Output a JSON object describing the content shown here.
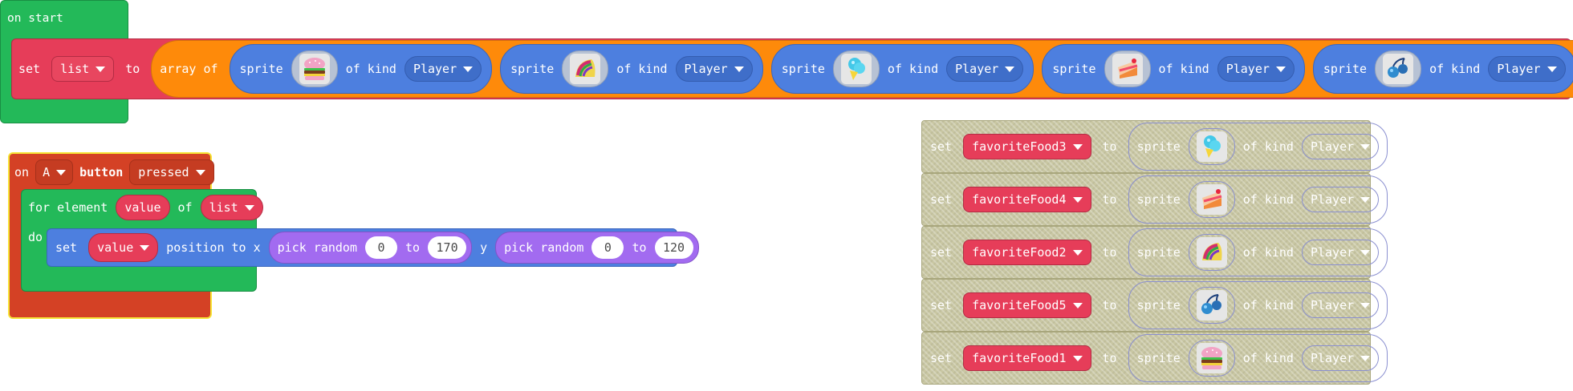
{
  "colors": {
    "event": "#23b959",
    "variable": "#e63d59",
    "array": "#fe8a0a",
    "sprite": "#4d7fdf",
    "math": "#a26bf0",
    "controller": "#d44125",
    "disabled": "#c9c7a3"
  },
  "on_start": {
    "hat_label": "on start",
    "set_label": "set",
    "var": "list",
    "to_label": "to",
    "array_label": "array of",
    "items": [
      {
        "sprite_label": "sprite",
        "icon": "burger-icon",
        "kind_label": "of kind",
        "kind": "Player"
      },
      {
        "sprite_label": "sprite",
        "icon": "taco-icon",
        "kind_label": "of kind",
        "kind": "Player"
      },
      {
        "sprite_label": "sprite",
        "icon": "ice-cream-icon",
        "kind_label": "of kind",
        "kind": "Player"
      },
      {
        "sprite_label": "sprite",
        "icon": "cake-icon",
        "kind_label": "of kind",
        "kind": "Player"
      },
      {
        "sprite_label": "sprite",
        "icon": "cherries-icon",
        "kind_label": "of kind",
        "kind": "Player"
      }
    ],
    "remove_symbol": "−",
    "add_symbol": "+"
  },
  "on_button": {
    "on_label": "on",
    "button": "A",
    "button_label": "button",
    "event": "pressed",
    "for_label": "for element",
    "elem_var": "value",
    "of_label": "of",
    "list_var": "list",
    "do_label": "do",
    "set_label": "set",
    "target_var": "value",
    "position_label": "position to x",
    "pick1_label": "pick random",
    "pick1_from": "0",
    "pick1_to_label": "to",
    "pick1_to": "170",
    "y_label": "y",
    "pick2_label": "pick random",
    "pick2_from": "0",
    "pick2_to_label": "to",
    "pick2_to": "120"
  },
  "disabled_sets": [
    {
      "set_label": "set",
      "var": "favoriteFood3",
      "to_label": "to",
      "sprite_label": "sprite",
      "icon": "ice-cream-icon",
      "kind_label": "of kind",
      "kind": "Player"
    },
    {
      "set_label": "set",
      "var": "favoriteFood4",
      "to_label": "to",
      "sprite_label": "sprite",
      "icon": "cake-icon",
      "kind_label": "of kind",
      "kind": "Player"
    },
    {
      "set_label": "set",
      "var": "favoriteFood2",
      "to_label": "to",
      "sprite_label": "sprite",
      "icon": "taco-icon",
      "kind_label": "of kind",
      "kind": "Player"
    },
    {
      "set_label": "set",
      "var": "favoriteFood5",
      "to_label": "to",
      "sprite_label": "sprite",
      "icon": "cherries-icon",
      "kind_label": "of kind",
      "kind": "Player"
    },
    {
      "set_label": "set",
      "var": "favoriteFood1",
      "to_label": "to",
      "sprite_label": "sprite",
      "icon": "burger-icon",
      "kind_label": "of kind",
      "kind": "Player"
    }
  ]
}
